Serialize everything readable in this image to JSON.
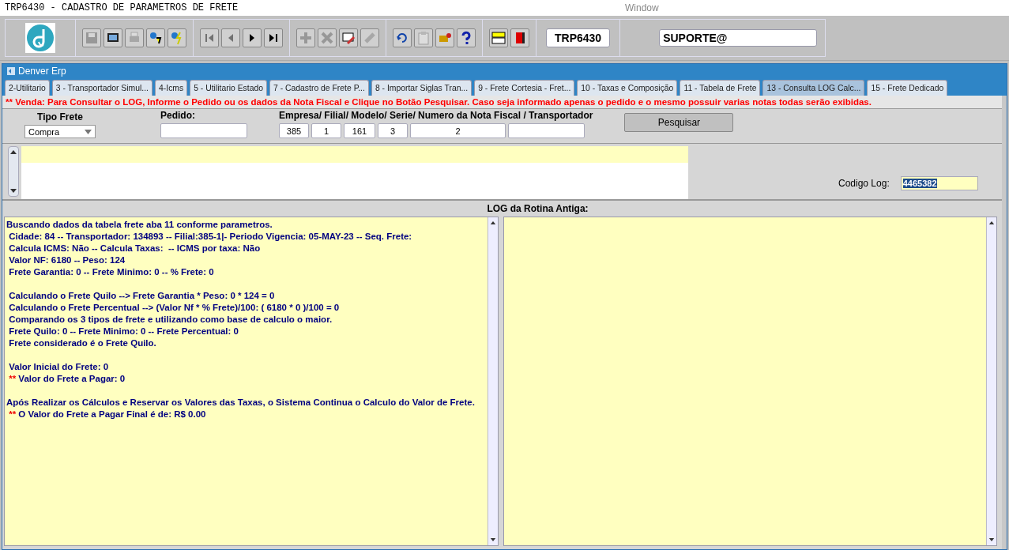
{
  "window": {
    "title": "TRP6430 - CADASTRO DE PARAMETROS DE FRETE",
    "menu_title": "Window"
  },
  "toolbar": {
    "groups": [
      [
        {
          "disabled": true
        },
        {
          "disabled": false
        },
        {
          "disabled": true
        },
        {
          "disabled": false
        },
        {
          "disabled": false
        }
      ],
      [
        {
          "disabled": true
        },
        {
          "disabled": true
        },
        {
          "disabled": false
        },
        {
          "disabled": false
        }
      ],
      [
        {
          "disabled": true
        },
        {
          "disabled": true
        },
        {
          "disabled": false
        },
        {
          "disabled": true
        }
      ],
      [
        {
          "disabled": false
        },
        {
          "disabled": true
        },
        {
          "disabled": false
        },
        {
          "disabled": false
        }
      ],
      [
        {
          "disabled": false
        },
        {
          "disabled": false
        }
      ]
    ],
    "form_code": "TRP6430",
    "user": "SUPORTE@"
  },
  "app_title": "Denver Erp",
  "tabs": [
    {
      "label": "2-Utilitario",
      "selected": false
    },
    {
      "label": "3 - Transportador Simul...",
      "selected": false
    },
    {
      "label": "4-Icms",
      "selected": false
    },
    {
      "label": "5 - Utilitario Estado",
      "selected": false
    },
    {
      "label": "7 - Cadastro de Frete P...",
      "selected": false
    },
    {
      "label": "8 - Importar Siglas Tran...",
      "selected": false
    },
    {
      "label": "9 - Frete Cortesia - Fret...",
      "selected": false
    },
    {
      "label": "10 - Taxas e Composição",
      "selected": false
    },
    {
      "label": "11 - Tabela de Frete",
      "selected": false
    },
    {
      "label": "13 - Consulta LOG Calc...",
      "selected": true
    },
    {
      "label": "15 - Frete Dedicado",
      "selected": false
    }
  ],
  "notice": "** Venda: Para Consultar o LOG, Informe o Pedido ou os dados da Nota Fiscal e Clique no Botão Pesquisar. Caso seja informado apenas o pedido e o mesmo possuir varias notas todas serão exibidas.",
  "form": {
    "tipo_frete": {
      "label": "Tipo Frete",
      "value": "Compra"
    },
    "pedido": {
      "label": "Pedido:"
    },
    "nota_label": "Empresa/ Filial/ Modelo/ Serie/ Numero da Nota Fiscal / Transportador",
    "nota_fields": [
      "385",
      "1",
      "161",
      "3",
      "2"
    ],
    "search_button": "Pesquisar"
  },
  "codigo_log": {
    "label": "Codigo Log:",
    "value": "4465382"
  },
  "log_header": "LOG da Rotina Antiga:",
  "log_blocks": [
    [
      {
        "text": "Buscando dados da tabela frete aba 11 conforme parametros."
      },
      {
        "text": " Cidade: 84 -- Transportador: 134893 -- Filial:385-1|- Periodo Vigencia: 05-MAY-23 -- Seq. Frete:"
      },
      {
        "text": " Calcula ICMS: Não -- Calcula Taxas:  -- ICMS por taxa: Não"
      },
      {
        "text": " Valor NF: 6180 -- Peso: 124"
      },
      {
        "text": " Frete Garantia: 0 -- Frete Minimo: 0 -- % Frete: 0"
      }
    ],
    [
      {
        "text": " Calculando o Frete Quilo --> Frete Garantia * Peso: 0 * 124 = 0"
      },
      {
        "text": " Calculando o Frete Percentual --> (Valor Nf * % Frete)/100: ( 6180 * 0 )/100 = 0"
      },
      {
        "text": " Comparando os 3 tipos de frete e utilizando como base de calculo o maior."
      },
      {
        "text": " Frete Quilo: 0 -- Frete Minimo: 0 -- Frete Percentual: 0"
      },
      {
        "text": " Frete considerado é o Frete Quilo."
      }
    ],
    [
      {
        "text": " Valor Inicial do Frete: 0"
      },
      {
        "marker": " **",
        "text": " Valor do Frete a Pagar: 0"
      }
    ],
    [
      {
        "text": "Após Realizar os Cálculos e Reservar os Valores das Taxas, o Sistema Continua o Calculo do Valor de Frete."
      },
      {
        "marker": " **",
        "text": " O Valor do Frete a Pagar Final é de: R$ 0.00"
      }
    ]
  ]
}
